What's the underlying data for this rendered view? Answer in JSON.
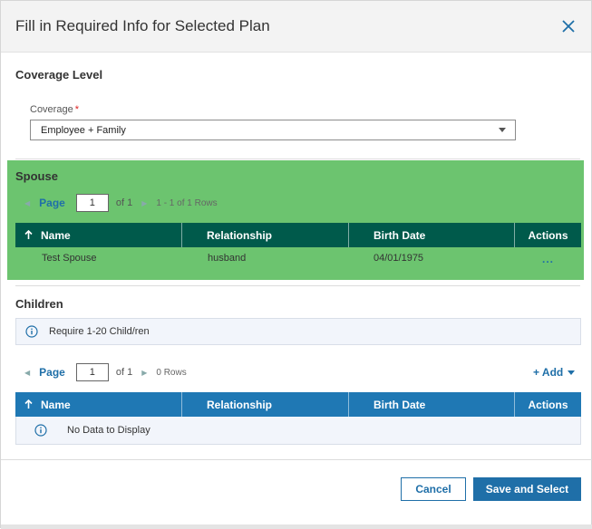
{
  "dialog": {
    "title": "Fill in Required Info for Selected Plan",
    "close_icon": "close-icon"
  },
  "coverage": {
    "section_title": "Coverage Level",
    "label": "Coverage",
    "required_mark": "*",
    "selected": "Employee + Family"
  },
  "spouse": {
    "section_title": "Spouse",
    "pager": {
      "page_label": "Page",
      "page_value": "1",
      "of_label": "of 1",
      "rows_label": "1 - 1 of 1 Rows"
    },
    "columns": [
      "Name",
      "Relationship",
      "Birth Date",
      "Actions"
    ],
    "rows": [
      {
        "name": "Test Spouse",
        "relationship": "husband",
        "birth_date": "04/01/1975",
        "actions": "..."
      }
    ],
    "header_color": "#005a4b"
  },
  "children": {
    "section_title": "Children",
    "info_message": "Require 1-20 Child/ren",
    "pager": {
      "page_label": "Page",
      "page_value": "1",
      "of_label": "of 1",
      "rows_label": "0 Rows"
    },
    "add_label": "+ Add",
    "columns": [
      "Name",
      "Relationship",
      "Birth Date",
      "Actions"
    ],
    "empty_message": "No Data to Display",
    "header_color": "#1f78b4"
  },
  "footer": {
    "cancel_label": "Cancel",
    "save_label": "Save and Select"
  },
  "colors": {
    "accent": "#1f6fa8",
    "highlight_overlay": "#4cb74f"
  }
}
